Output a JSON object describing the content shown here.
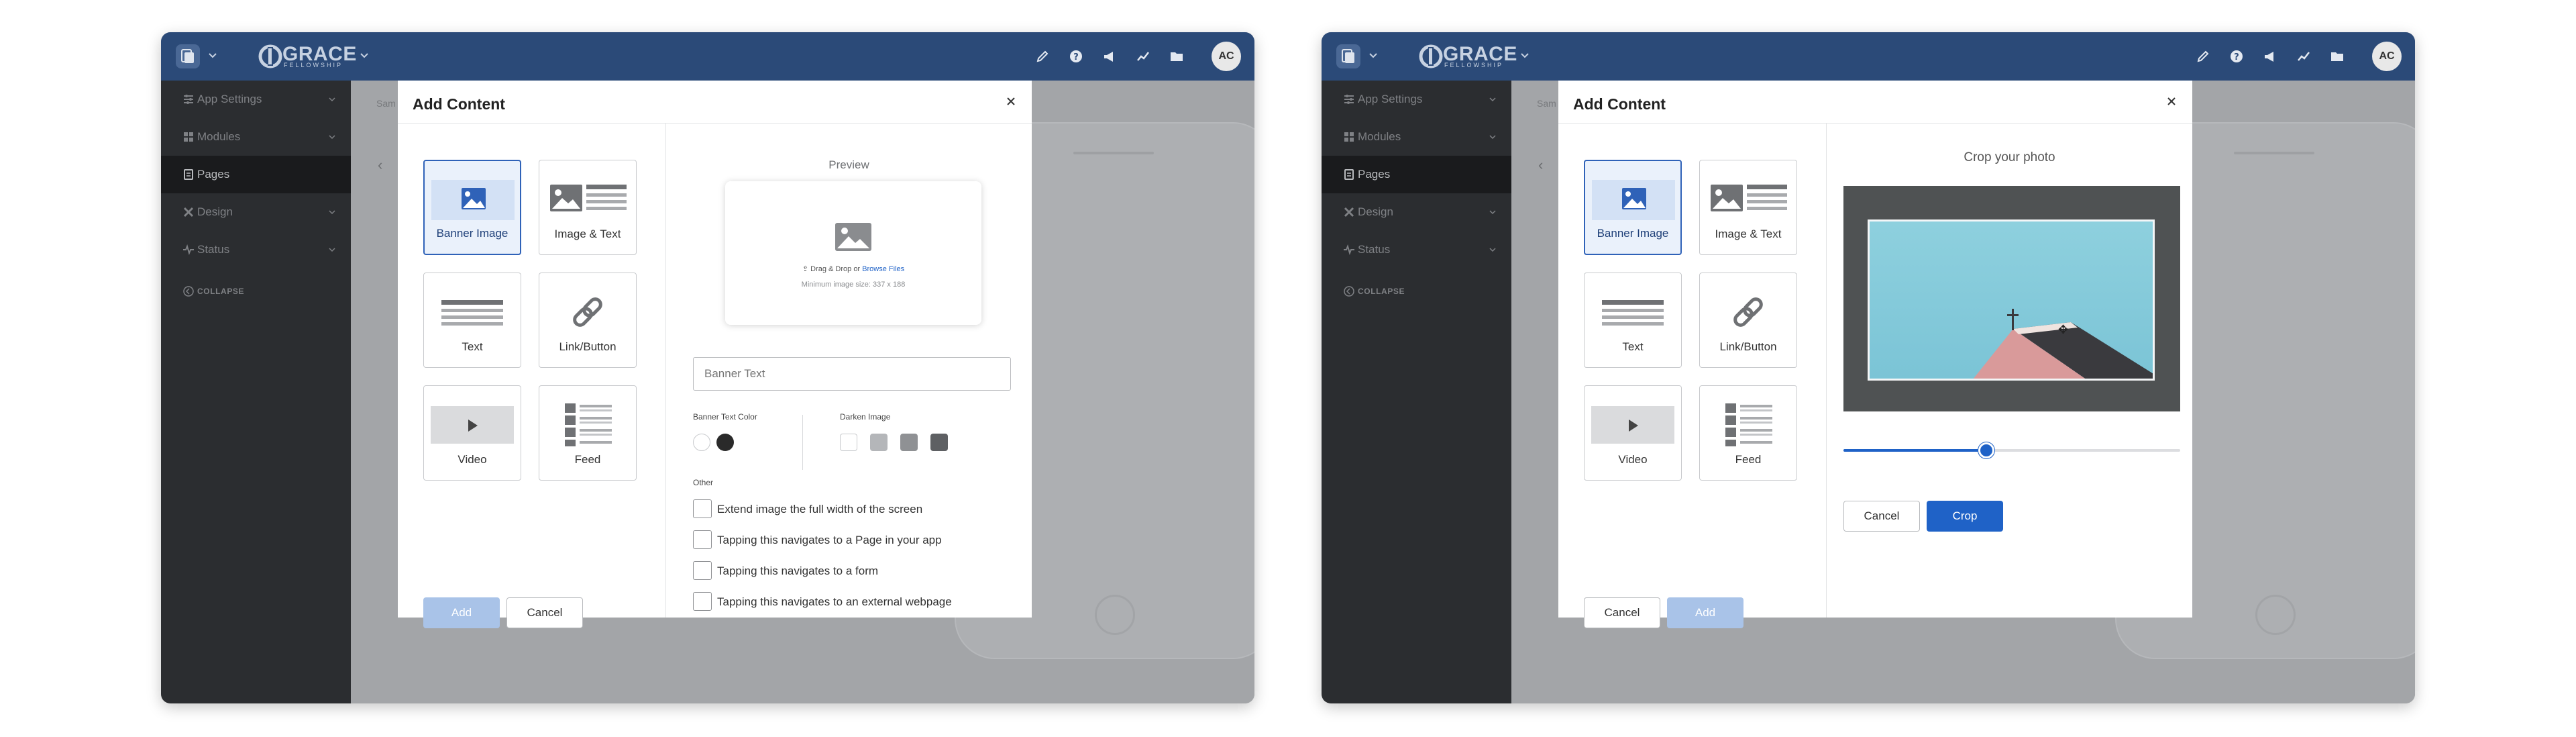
{
  "screens": [
    {
      "header": {
        "brand_name": "GRACE",
        "brand_sub": "FELLOWSHIP",
        "avatar_initials": "AC"
      },
      "sidebar": {
        "items": [
          {
            "label": "App Settings"
          },
          {
            "label": "Modules"
          },
          {
            "label": "Pages"
          },
          {
            "label": "Design"
          },
          {
            "label": "Status"
          },
          {
            "label": "COLLAPSE"
          }
        ]
      },
      "content": {
        "breadcrumb": "Sam"
      },
      "modal": {
        "title": "Add Content",
        "tiles": [
          {
            "label": "Banner Image"
          },
          {
            "label": "Image & Text"
          },
          {
            "label": "Text"
          },
          {
            "label": "Link/Button"
          },
          {
            "label": "Video"
          },
          {
            "label": "Feed"
          }
        ],
        "add_label": "Add",
        "cancel_label": "Cancel",
        "preview_label": "Preview",
        "drag_text": "Drag & Drop or",
        "browse_text": "Browse Files",
        "min_size_text": "Minimum image size: 337 x 188",
        "banner_text_placeholder": "Banner Text",
        "banner_text_color_label": "Banner Text Color",
        "darken_image_label": "Darken Image",
        "other_label": "Other",
        "options": [
          {
            "label": "Extend image the full width of the screen"
          },
          {
            "label": "Tapping this navigates to a Page in your app"
          },
          {
            "label": "Tapping this navigates to a form"
          },
          {
            "label": "Tapping this navigates to an external webpage"
          }
        ]
      }
    },
    {
      "header": {
        "brand_name": "GRACE",
        "brand_sub": "FELLOWSHIP",
        "avatar_initials": "AC"
      },
      "sidebar": {
        "items": [
          {
            "label": "App Settings"
          },
          {
            "label": "Modules"
          },
          {
            "label": "Pages"
          },
          {
            "label": "Design"
          },
          {
            "label": "Status"
          },
          {
            "label": "COLLAPSE"
          }
        ]
      },
      "content": {
        "breadcrumb": "Sam"
      },
      "modal": {
        "title": "Add Content",
        "tiles": [
          {
            "label": "Banner Image"
          },
          {
            "label": "Image & Text"
          },
          {
            "label": "Text"
          },
          {
            "label": "Link/Button"
          },
          {
            "label": "Video"
          },
          {
            "label": "Feed"
          }
        ],
        "add_label": "Add",
        "cancel_label": "Cancel",
        "crop_title": "Crop your photo",
        "zoom_level": 0.42,
        "crop_cancel_label": "Cancel",
        "crop_label": "Crop"
      }
    }
  ],
  "colors": {
    "header": "#2b4a78",
    "sidebar": "#2b2d30",
    "primary": "#1f62c7",
    "primary_disabled": "#a9c3e8",
    "selected_tile": "#eaf1fb"
  },
  "icons": {
    "header": [
      "edit-icon",
      "help-icon",
      "megaphone-icon",
      "chart-icon",
      "folder-icon"
    ],
    "sidebar": [
      "sliders-icon",
      "grid-icon",
      "pages-icon",
      "design-tools-icon",
      "pulse-icon",
      "collapse-icon"
    ],
    "tiles": [
      "image-icon",
      "image-text-icon",
      "text-lines-icon",
      "link-icon",
      "video-play-icon",
      "feed-icon"
    ]
  }
}
